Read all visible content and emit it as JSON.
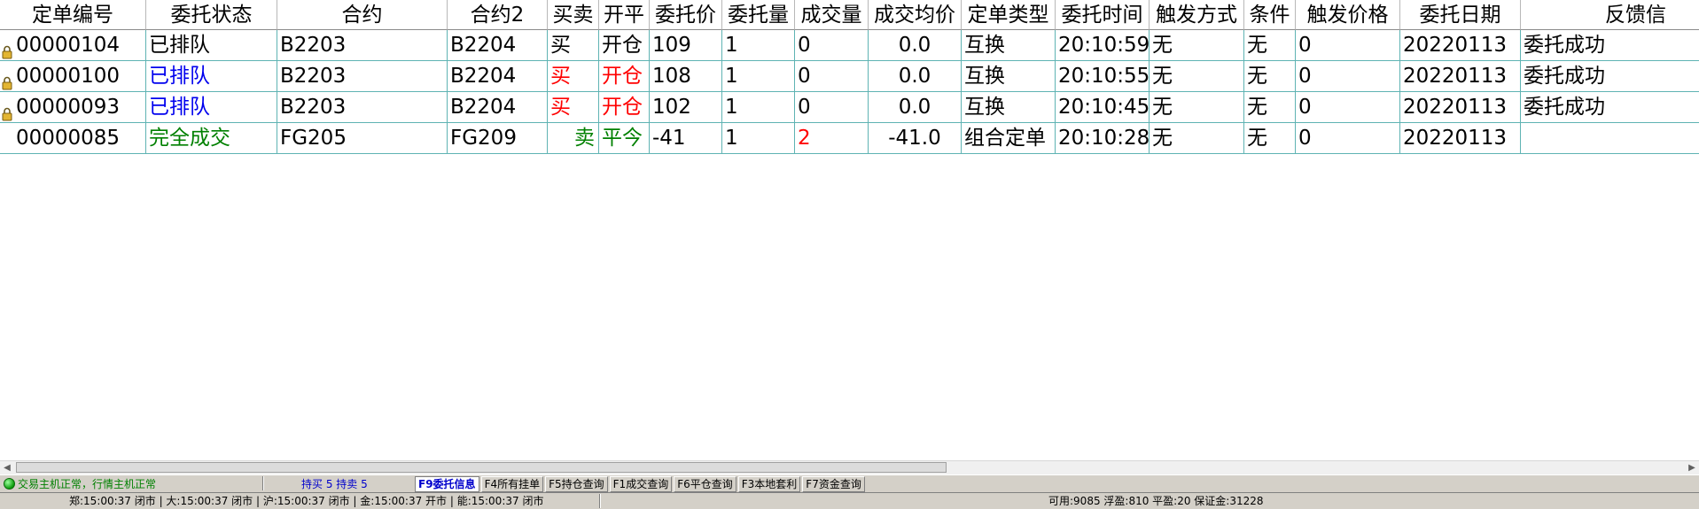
{
  "columns": [
    {
      "key": "order_no",
      "label": "定单编号",
      "sortable": true
    },
    {
      "key": "status",
      "label": "委托状态"
    },
    {
      "key": "contract",
      "label": "合约"
    },
    {
      "key": "contract2",
      "label": "合约2"
    },
    {
      "key": "side",
      "label": "买卖"
    },
    {
      "key": "open_close",
      "label": "开平"
    },
    {
      "key": "price",
      "label": "委托价"
    },
    {
      "key": "qty",
      "label": "委托量"
    },
    {
      "key": "filled_qty",
      "label": "成交量"
    },
    {
      "key": "avg_price",
      "label": "成交均价"
    },
    {
      "key": "order_type",
      "label": "定单类型"
    },
    {
      "key": "time",
      "label": "委托时间"
    },
    {
      "key": "trigger_mode",
      "label": "触发方式"
    },
    {
      "key": "condition",
      "label": "条件"
    },
    {
      "key": "trigger_price",
      "label": "触发价格"
    },
    {
      "key": "date",
      "label": "委托日期"
    },
    {
      "key": "feedback",
      "label": "反馈信"
    }
  ],
  "rows": [
    {
      "locked": true,
      "order_no": "00000104",
      "status": "已排队",
      "contract": "B2203",
      "contract2": "B2204",
      "side": "买",
      "open_close": "开仓",
      "price": "109",
      "qty": "1",
      "filled_qty": "0",
      "avg_price": "0.0",
      "order_type": "互换",
      "time": "20:10:59",
      "trigger_mode": "无",
      "condition": "无",
      "trigger_price": "0",
      "date": "20220113",
      "feedback": "委托成功",
      "colors": {
        "status": "#000000",
        "side": "#000000",
        "open_close": "#000000",
        "filled_qty": "#000000"
      }
    },
    {
      "locked": true,
      "order_no": "00000100",
      "status": "已排队",
      "contract": "B2203",
      "contract2": "B2204",
      "side": "买",
      "open_close": "开仓",
      "price": "108",
      "qty": "1",
      "filled_qty": "0",
      "avg_price": "0.0",
      "order_type": "互换",
      "time": "20:10:55",
      "trigger_mode": "无",
      "condition": "无",
      "trigger_price": "0",
      "date": "20220113",
      "feedback": "委托成功",
      "colors": {
        "status": "#0000ee",
        "side": "#ff0000",
        "open_close": "#ff0000",
        "filled_qty": "#000000"
      }
    },
    {
      "locked": true,
      "order_no": "00000093",
      "status": "已排队",
      "contract": "B2203",
      "contract2": "B2204",
      "side": "买",
      "open_close": "开仓",
      "price": "102",
      "qty": "1",
      "filled_qty": "0",
      "avg_price": "0.0",
      "order_type": "互换",
      "time": "20:10:45",
      "trigger_mode": "无",
      "condition": "无",
      "trigger_price": "0",
      "date": "20220113",
      "feedback": "委托成功",
      "colors": {
        "status": "#0000ee",
        "side": "#ff0000",
        "open_close": "#ff0000",
        "filled_qty": "#000000"
      }
    },
    {
      "locked": false,
      "order_no": "00000085",
      "status": "完全成交",
      "contract": "FG205",
      "contract2": "FG209",
      "side": "卖",
      "open_close": "平今",
      "price": "-41",
      "qty": "1",
      "filled_qty": "2",
      "avg_price": "-41.0",
      "order_type": "组合定单",
      "time": "20:10:28",
      "trigger_mode": "无",
      "condition": "无",
      "trigger_price": "0",
      "date": "20220113",
      "feedback": "",
      "colors": {
        "status": "#008000",
        "side": "#008000",
        "open_close": "#008000",
        "filled_qty": "#ff0000"
      }
    }
  ],
  "statusbar": {
    "connection_text": "交易主机正常，行情主机正常",
    "holdings_text": "持买 5  持卖 5",
    "tabs": [
      {
        "label": "F9委托信息",
        "active": true
      },
      {
        "label": "F4所有挂单",
        "active": false
      },
      {
        "label": "F5持仓查询",
        "active": false
      },
      {
        "label": "F1成交查询",
        "active": false
      },
      {
        "label": "F6平仓查询",
        "active": false
      },
      {
        "label": "F3本地套利",
        "active": false
      },
      {
        "label": "F7资金查询",
        "active": false
      }
    ]
  },
  "infobar": {
    "markets_text": "郑:15:00:37 闭市 | 大:15:00:37 闭市 | 沪:15:00:37 闭市 | 金:15:00:37 开市 | 能:15:00:37 闭市",
    "account_text": "可用:9085 浮盈:810 平盈:20 保证金:31228"
  },
  "icons": {
    "lock": "lock-icon",
    "sort": "sort-arrow-icon",
    "connection": "connection-status-icon"
  },
  "theme": {
    "grid_line": "#5fb3b3",
    "blue_text": "#0000ee",
    "red_text": "#ff0000",
    "green_text": "#008000",
    "chrome": "#d4d0c8"
  }
}
